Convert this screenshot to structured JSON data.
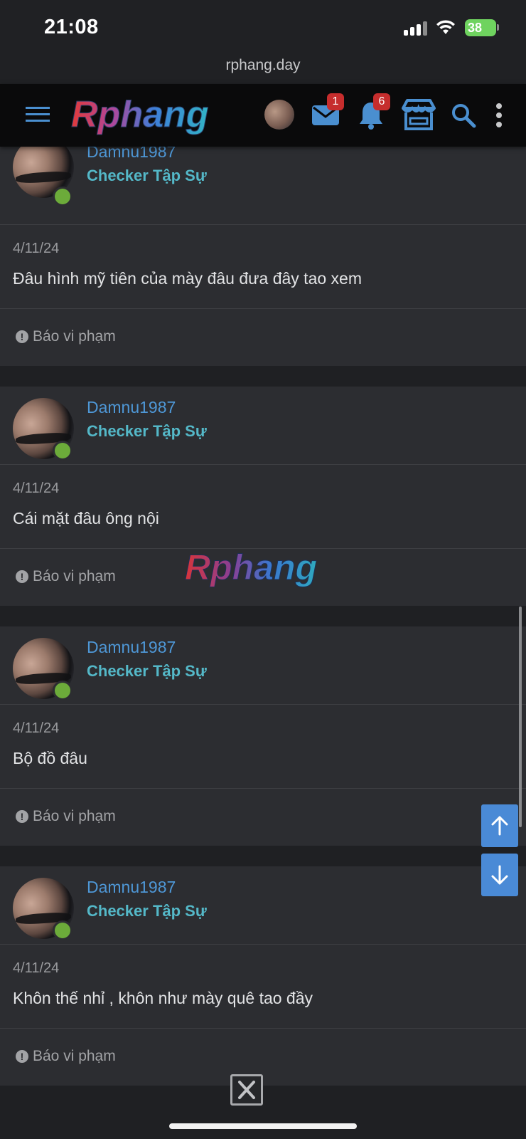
{
  "status_bar": {
    "time": "21:08",
    "battery": "38"
  },
  "browser": {
    "url": "rphang.day"
  },
  "header": {
    "logo_text": "Rphang",
    "messages_badge": "1",
    "alerts_badge": "6"
  },
  "posts": [
    {
      "username": "Damnu1987",
      "user_title": "Checker Tập Sự",
      "date": "4/11/24",
      "text": "Đâu hình mỹ tiên của mày đâu đưa đây tao xem",
      "report_label": "Báo vi phạm"
    },
    {
      "username": "Damnu1987",
      "user_title": "Checker Tập Sự",
      "date": "4/11/24",
      "text": "Cái mặt đâu ông nội",
      "report_label": "Báo vi phạm"
    },
    {
      "username": "Damnu1987",
      "user_title": "Checker Tập Sự",
      "date": "4/11/24",
      "text": "Bộ đồ đâu",
      "report_label": "Báo vi phạm"
    },
    {
      "username": "Damnu1987",
      "user_title": "Checker Tập Sự",
      "date": "4/11/24",
      "text": "Khôn thế nhỉ , khôn như mày quê tao đầy",
      "report_label": "Báo vi phạm"
    }
  ],
  "watermark_text": "Rphang",
  "colors": {
    "accent": "#4e97d6",
    "user_title": "#54b8c8",
    "online": "#6cab3a",
    "badge": "#c62d2d"
  },
  "icons": [
    "menu-icon",
    "mail-icon",
    "bell-icon",
    "store-icon",
    "search-icon",
    "more-vertical-icon",
    "arrow-up-icon",
    "arrow-down-icon",
    "close-icon"
  ]
}
